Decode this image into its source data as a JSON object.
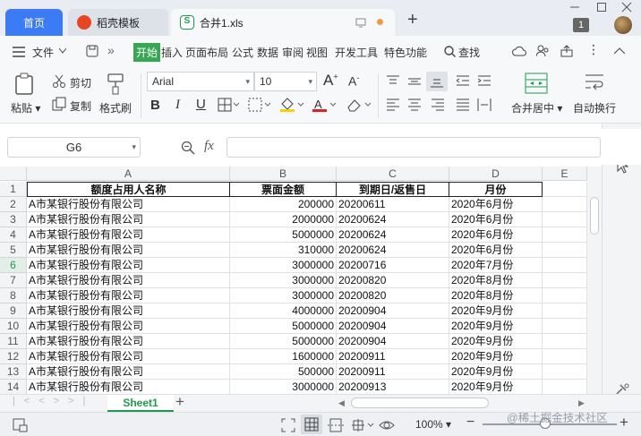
{
  "tabs": {
    "home": "首页",
    "template": "稻壳模板",
    "file": "合并1.xls"
  },
  "window": {
    "badge": "1"
  },
  "menu": {
    "file": "文件",
    "items": [
      "开始",
      "插入",
      "页面布局",
      "公式",
      "数据",
      "审阅",
      "视图",
      "开发工具",
      "特色功能"
    ],
    "search": "查找"
  },
  "ribbon": {
    "paste": "粘贴",
    "cut": "剪切",
    "copy": "复制",
    "format_painter": "格式刷",
    "font_name": "Arial",
    "font_size": "10",
    "merge_center": "合并居中",
    "wrap_text": "自动换行",
    "bold": "B",
    "italic": "I",
    "underline": "U",
    "grow_font": "A",
    "shrink_font": "A"
  },
  "formula_bar": {
    "name_box": "G6",
    "fx": "fx",
    "content": ""
  },
  "grid": {
    "columns": [
      "A",
      "B",
      "C",
      "D",
      "E"
    ],
    "header": [
      "额度占用人名称",
      "票面金额",
      "到期日/返售日",
      "月份"
    ],
    "rows": [
      [
        "A市某银行股份有限公司",
        "200000",
        "20200611",
        "2020年6月份"
      ],
      [
        "A市某银行股份有限公司",
        "2000000",
        "20200624",
        "2020年6月份"
      ],
      [
        "A市某银行股份有限公司",
        "5000000",
        "20200624",
        "2020年6月份"
      ],
      [
        "A市某银行股份有限公司",
        "310000",
        "20200624",
        "2020年6月份"
      ],
      [
        "A市某银行股份有限公司",
        "3000000",
        "20200716",
        "2020年7月份"
      ],
      [
        "A市某银行股份有限公司",
        "3000000",
        "20200820",
        "2020年8月份"
      ],
      [
        "A市某银行股份有限公司",
        "3000000",
        "20200820",
        "2020年8月份"
      ],
      [
        "A市某银行股份有限公司",
        "4000000",
        "20200904",
        "2020年9月份"
      ],
      [
        "A市某银行股份有限公司",
        "5000000",
        "20200904",
        "2020年9月份"
      ],
      [
        "A市某银行股份有限公司",
        "5000000",
        "20200904",
        "2020年9月份"
      ],
      [
        "A市某银行股份有限公司",
        "1600000",
        "20200911",
        "2020年9月份"
      ],
      [
        "A市某银行股份有限公司",
        "500000",
        "20200911",
        "2020年9月份"
      ],
      [
        "A市某银行股份有限公司",
        "3000000",
        "20200913",
        "2020年9月份"
      ]
    ]
  },
  "sheet_tabs": [
    "Sheet1"
  ],
  "status": {
    "zoom": "100%",
    "watermark": "@稀土掘金技术社区"
  },
  "colors": {
    "accent": "#3c7bf6",
    "start_tab": "#36a852",
    "sheet_tab_text": "#1a9d4c"
  }
}
